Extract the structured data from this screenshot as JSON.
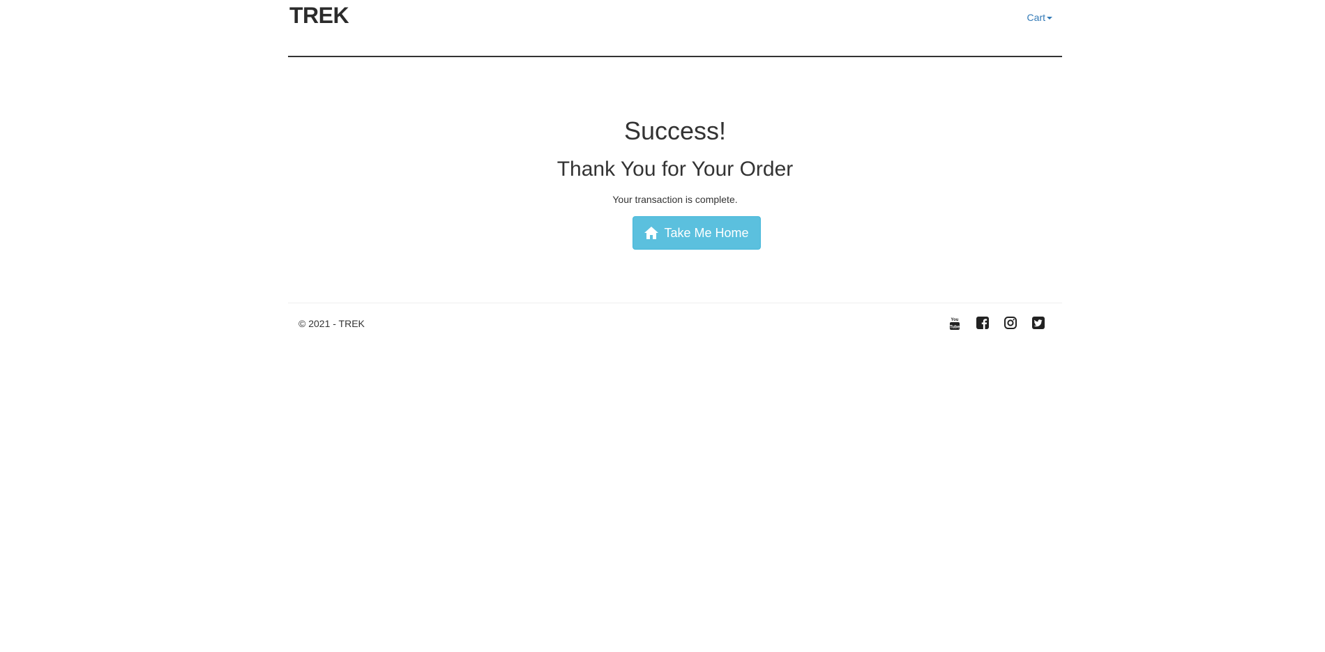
{
  "header": {
    "brand": "TREK",
    "cart_label": "Cart"
  },
  "main": {
    "title": "Success!",
    "subtitle": "Thank You for Your Order",
    "message": "Your transaction is complete.",
    "home_button_label": "Take Me Home",
    "home_button_icon": "home-icon"
  },
  "footer": {
    "copyright": "© 2021 - TREK",
    "social_icons": [
      "youtube-icon",
      "facebook-icon",
      "instagram-icon",
      "twitter-icon"
    ]
  },
  "colors": {
    "button_bg": "#5bc0de",
    "link": "#337ab7",
    "text": "#333333",
    "divider": "#333333"
  }
}
